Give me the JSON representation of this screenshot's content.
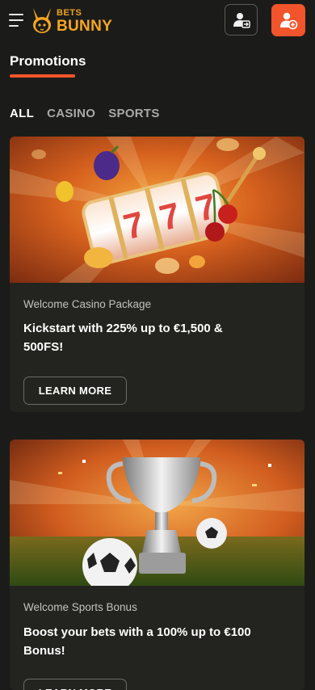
{
  "header": {
    "logo_top": "BETS",
    "logo_bottom": "BUNNY"
  },
  "page": {
    "title": "Promotions"
  },
  "tabs": [
    {
      "label": "ALL",
      "active": true
    },
    {
      "label": "CASINO",
      "active": false
    },
    {
      "label": "SPORTS",
      "active": false
    }
  ],
  "promotions": [
    {
      "subtitle": "Welcome Casino Package",
      "headline": "Kickstart with 225% up to €1,500 & 500FS!",
      "button": "LEARN MORE",
      "image": "slot-machine-777"
    },
    {
      "subtitle": "Welcome Sports Bonus",
      "headline": "Boost your bets with a 100% up to €100 Bonus!",
      "button": "LEARN MORE",
      "image": "trophy-footballs"
    }
  ],
  "colors": {
    "background": "#1b1c19",
    "card": "#23241f",
    "accent": "#f2542b",
    "logo": "#f5a623"
  }
}
